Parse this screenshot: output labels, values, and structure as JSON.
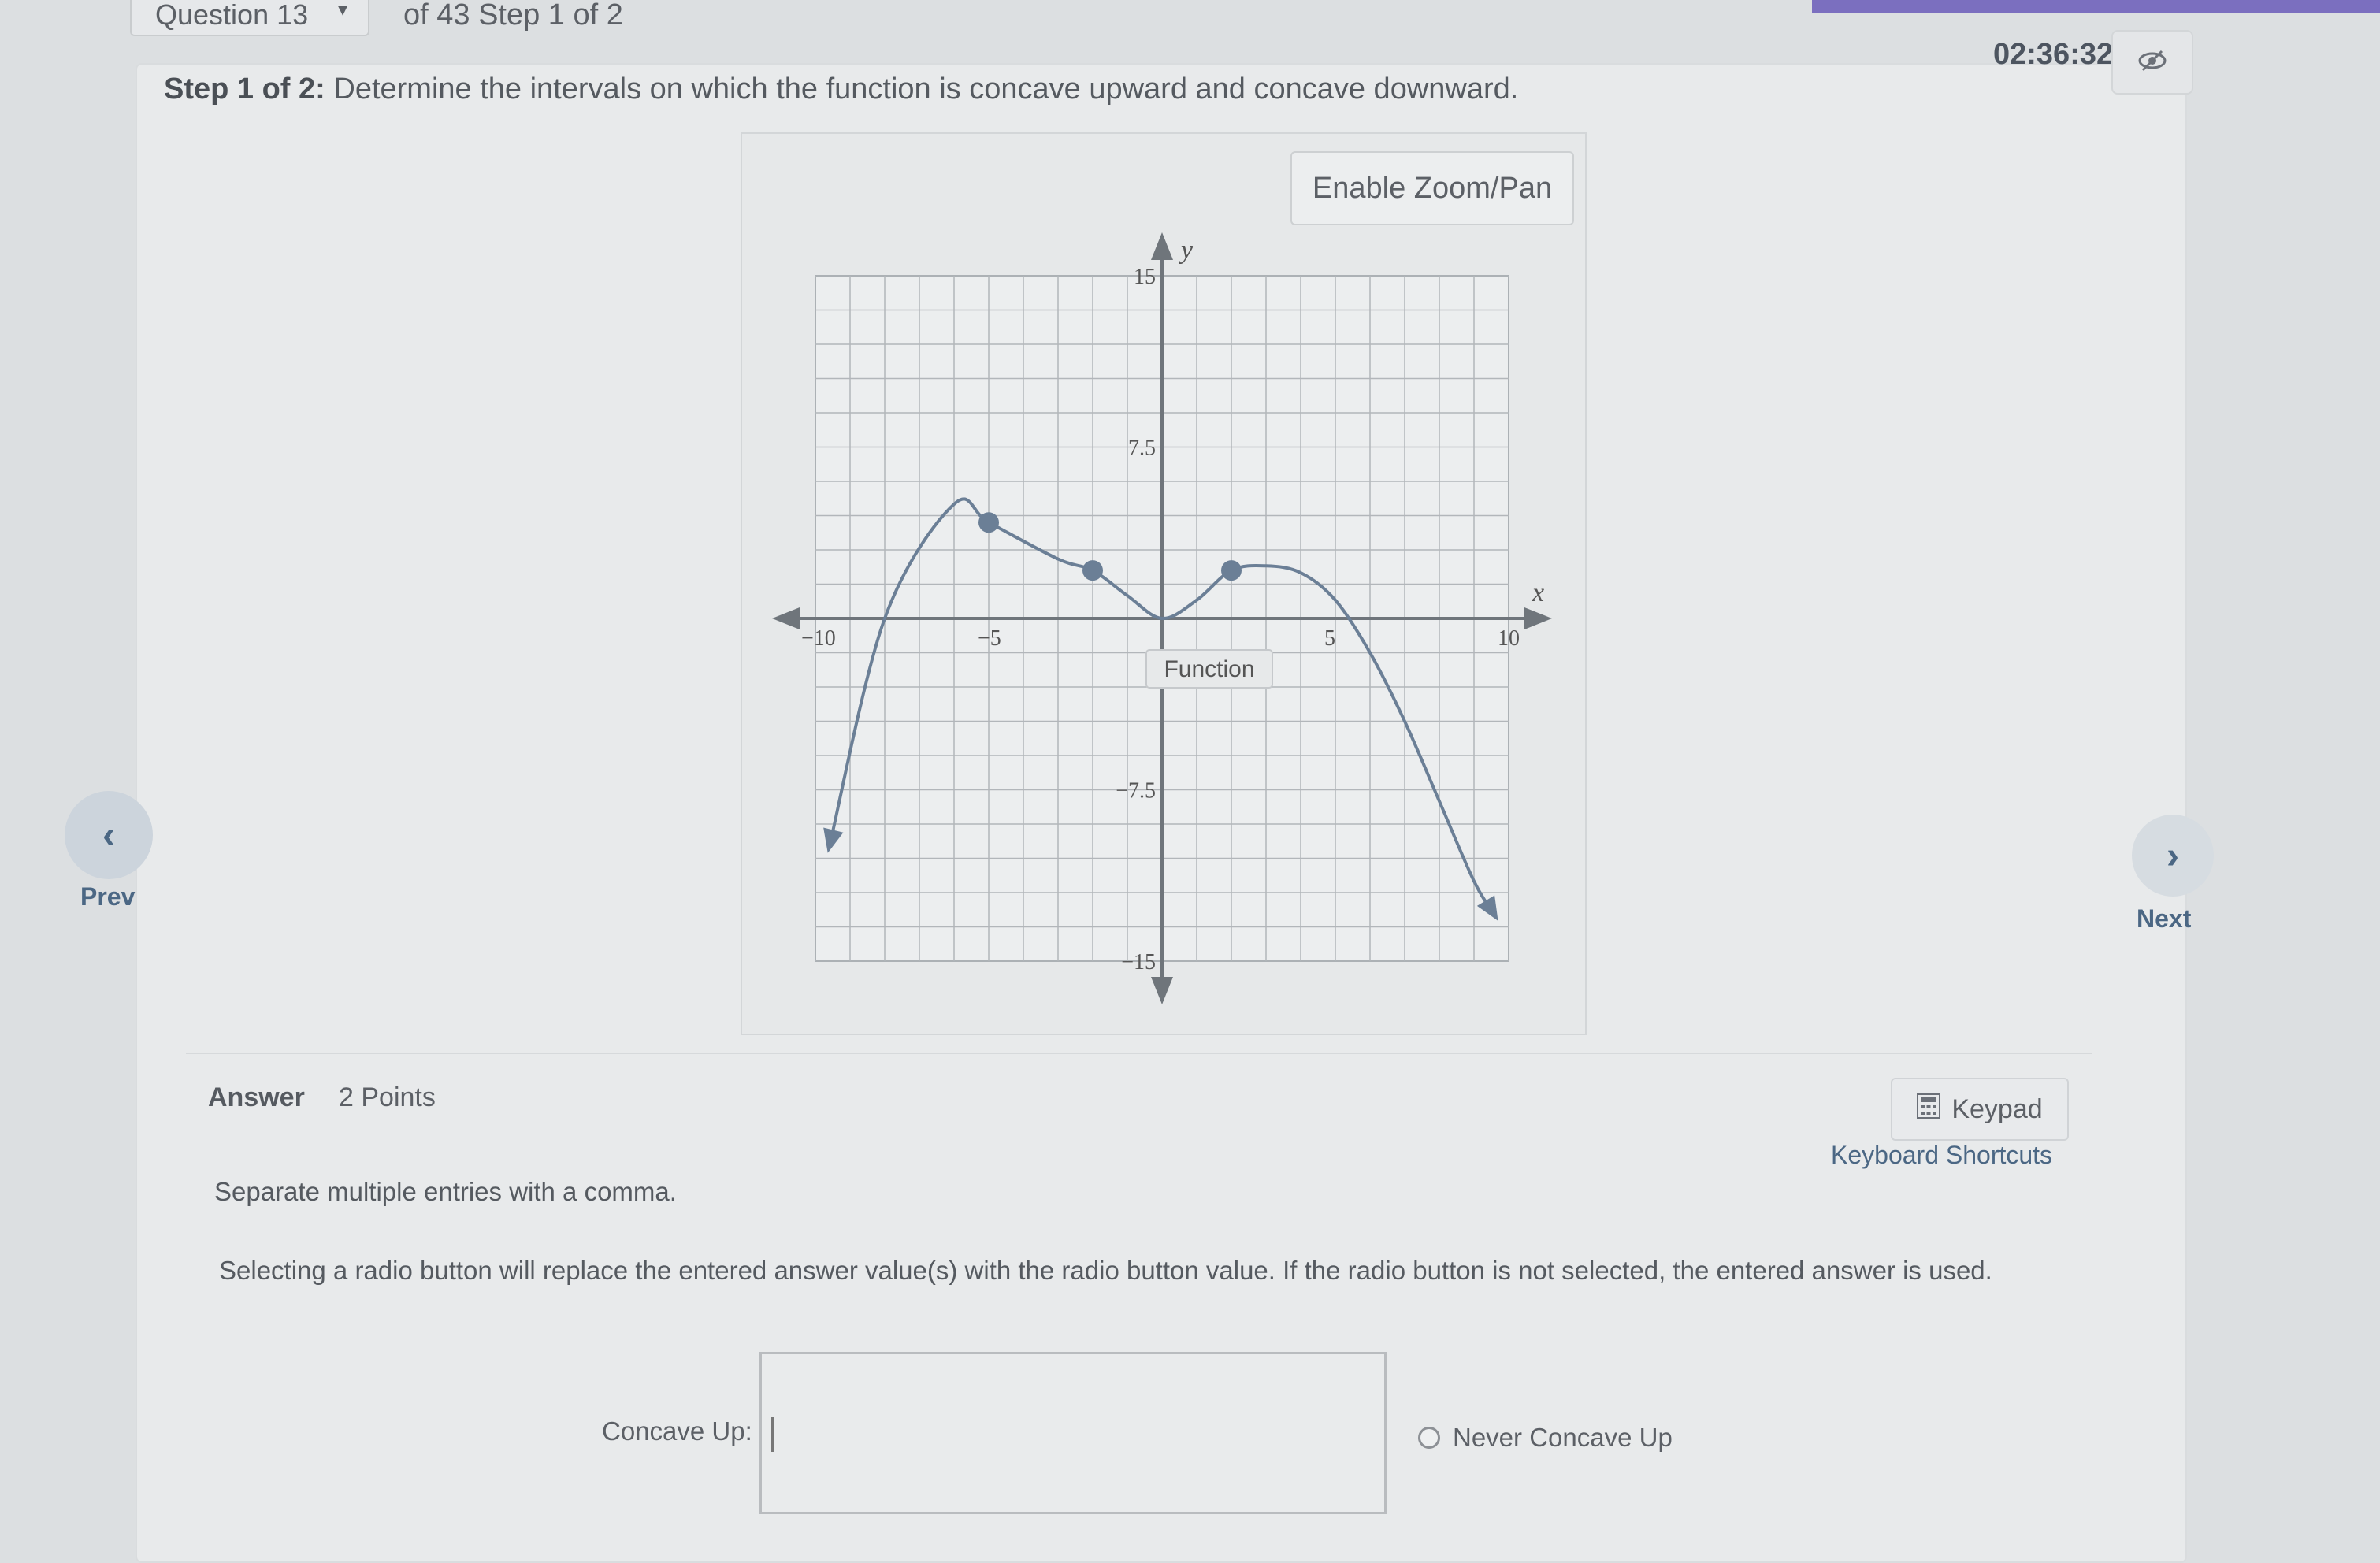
{
  "header": {
    "question_label": "Question 13",
    "question_of": "of 43 Step 1 of 2",
    "timer": "02:36:32"
  },
  "colors": {
    "accent": "#7b6fbf",
    "nav": "#4b6784",
    "curve": "#6b7f96"
  },
  "icons": {
    "hide_timer": "eye-slash-icon",
    "dropdown": "caret-down-icon",
    "keypad": "calculator-icon",
    "prev": "chevron-left-icon",
    "next": "chevron-right-icon"
  },
  "step": {
    "prefix": "Step 1 of 2:",
    "text": "Determine the intervals on which the function is concave upward and concave downward."
  },
  "zoom_button": "Enable Zoom/Pan",
  "chart_data": {
    "type": "line",
    "xlabel": "x",
    "ylabel": "y",
    "xlim": [
      -10,
      10
    ],
    "ylim": [
      -15,
      15
    ],
    "x_ticks": [
      "−10",
      "−5",
      "5",
      "10"
    ],
    "y_ticks": [
      "15",
      "7.5",
      "−7.5",
      "−15"
    ],
    "grid": true,
    "series": [
      {
        "x": [
          -9.6,
          -8,
          -6,
          -5,
          -3,
          -2,
          -1,
          0,
          1,
          2,
          3,
          4,
          5,
          6,
          7,
          8,
          9,
          9.6
        ],
        "y": [
          -10,
          0,
          5,
          4.2,
          2.6,
          2.1,
          1,
          0,
          0.8,
          2.1,
          2.3,
          2,
          0.8,
          -1.5,
          -4.5,
          -8,
          -11.5,
          -13
        ]
      }
    ],
    "marked_points": [
      {
        "x": -5,
        "y": 4.2
      },
      {
        "x": -2,
        "y": 2.1
      },
      {
        "x": 2,
        "y": 2.1
      }
    ],
    "tooltip": "Function"
  },
  "nav": {
    "prev": "Prev",
    "next": "Next"
  },
  "answer": {
    "label": "Answer",
    "points": "2 Points",
    "keypad": "Keypad",
    "shortcuts": "Keyboard Shortcuts",
    "instruction1": "Separate multiple entries with a comma.",
    "instruction2": "Selecting a radio button will replace the entered answer value(s) with the radio button value. If the radio button is not selected, the entered answer is used.",
    "concave_up_label": "Concave Up:",
    "concave_up_value": "",
    "never_label": "Never Concave Up"
  }
}
